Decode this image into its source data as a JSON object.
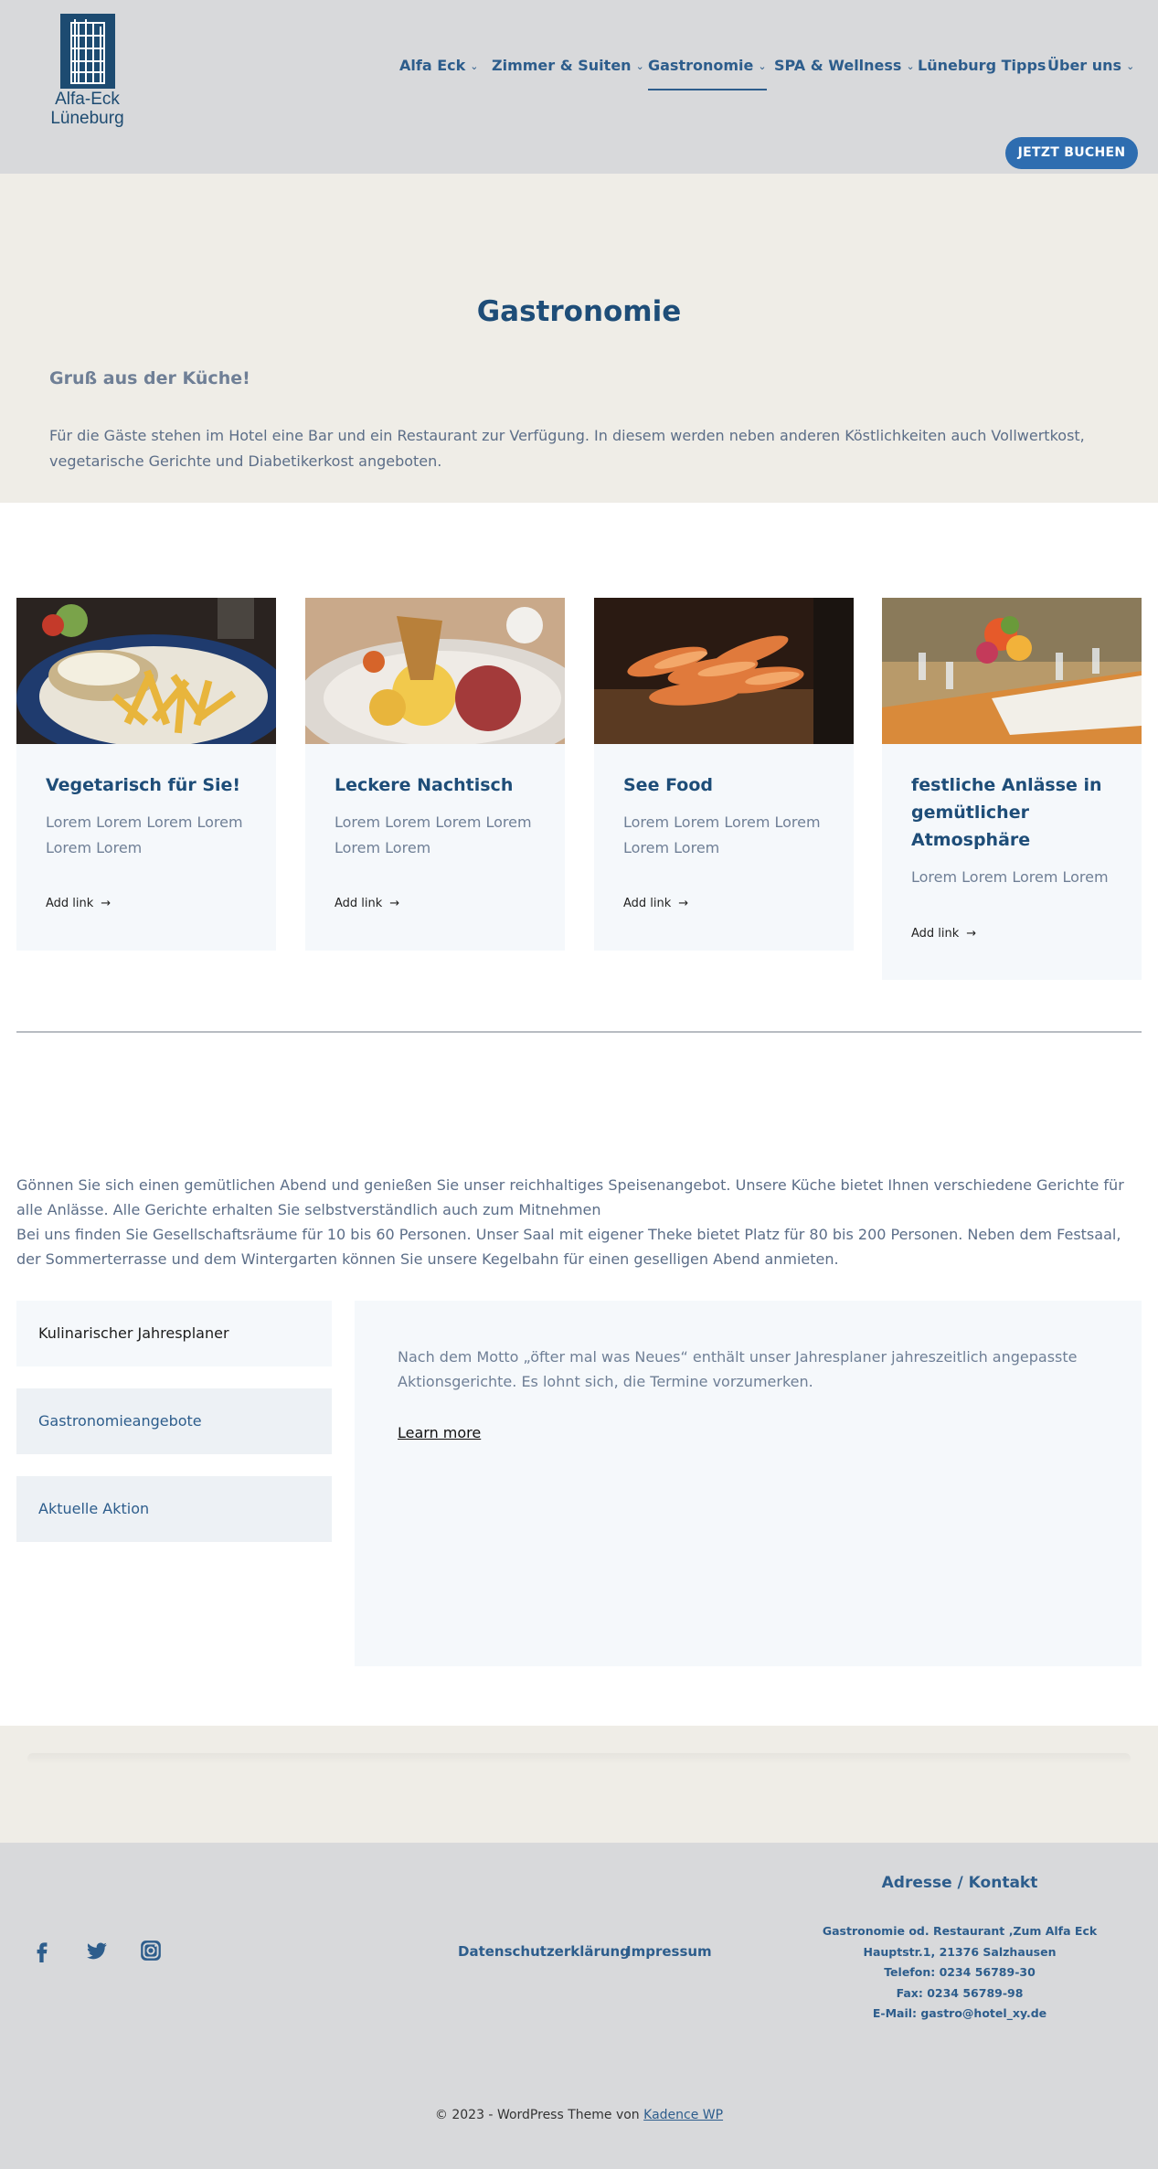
{
  "brand": {
    "logo_line1": "Alfa-Eck",
    "logo_line2": "Lüneburg",
    "color": "#1d4b71"
  },
  "nav": {
    "items": [
      {
        "label": "Alfa Eck",
        "has_dropdown": true
      },
      {
        "label": "Zimmer & Suiten",
        "has_dropdown": true
      },
      {
        "label": "Gastronomie",
        "has_dropdown": true,
        "active": true
      },
      {
        "label": "SPA & Wellness",
        "has_dropdown": true
      },
      {
        "label": "Lüneburg Tipps",
        "has_dropdown": false
      },
      {
        "label": "Über uns",
        "has_dropdown": true
      }
    ],
    "cta": "JETZT BUCHEN"
  },
  "hero": {
    "title": "Gastronomie",
    "subtitle": "Gruß aus der Küche!",
    "text": "Für die Gäste stehen im Hotel eine Bar und ein Restaurant zur Verfügung. In diesem werden neben anderen Köstlichkeiten auch Vollwertkost, vegetarische Gerichte und Diabetikerkost angeboten."
  },
  "cards": [
    {
      "title": "Vegetarisch für Sie!",
      "text": "Lorem Lorem Lorem Lorem Lorem Lorem",
      "link": "Add link",
      "image": "fries-dish-photo"
    },
    {
      "title": "Leckere Nachtisch",
      "text": "Lorem Lorem Lorem Lorem Lorem Lorem",
      "link": "Add link",
      "image": "ice-cream-dessert-photo"
    },
    {
      "title": "See Food",
      "text": "Lorem Lorem Lorem Lorem Lorem Lorem",
      "link": "Add link",
      "image": "shrimp-platter-photo"
    },
    {
      "title": "festliche Anlässe in gemütlicher Atmosphäre",
      "text": "Lorem Lorem Lorem Lorem",
      "link": "Add link",
      "image": "banquet-table-photo"
    }
  ],
  "intro": {
    "line1": "Gönnen Sie sich einen gemütlichen Abend und genießen Sie unser reichhaltiges Speisenangebot. Unsere Küche bietet Ihnen verschiedene Gerichte für alle Anlässe. Alle Gerichte erhalten Sie selbstverständlich auch zum Mitnehmen",
    "line2": "Bei uns finden Sie Gesellschaftsräume für 10 bis 60 Personen. Unser Saal mit eigener Theke bietet Platz für 80 bis 200 Personen. Neben dem Festsaal, der Sommerterrasse und dem Wintergarten können Sie unsere Kegelbahn für einen geselligen Abend anmieten."
  },
  "tabs": {
    "items": [
      {
        "label": "Kulinarischer Jahresplaner",
        "active": true
      },
      {
        "label": "Gastronomieangebote",
        "active": false
      },
      {
        "label": "Aktuelle Aktion",
        "active": false
      }
    ],
    "panel_text": "Nach dem Motto „öfter mal was Neues“ enthält unser Jahresplaner jahreszeitlich angepasste Aktionsgerichte. Es lohnt sich, die Termine vorzumerken.",
    "panel_link": "Learn more"
  },
  "footer": {
    "social": [
      "facebook-icon",
      "twitter-icon",
      "instagram-icon"
    ],
    "links": [
      "Datenschutzerklärung",
      "Impressum"
    ],
    "contact_title": "Adresse / Kontakt",
    "contact_lines": [
      "Gastronomie od. Restaurant ‚Zum Alfa Eck",
      "Hauptstr.1, 21376 Salzhausen",
      "Telefon: 0234 56789-30",
      "Fax: 0234 56789-98",
      "E-Mail: gastro@hotel_xy.de"
    ],
    "copyright_prefix": "© 2023 - WordPress Theme von",
    "copyright_link": "Kadence WP"
  },
  "colors": {
    "header_bg": "#d8d9db",
    "beige": "#efede7",
    "accent": "#2e6db0",
    "heading": "#1e4d78",
    "card_bg": "#f5f8fb"
  }
}
